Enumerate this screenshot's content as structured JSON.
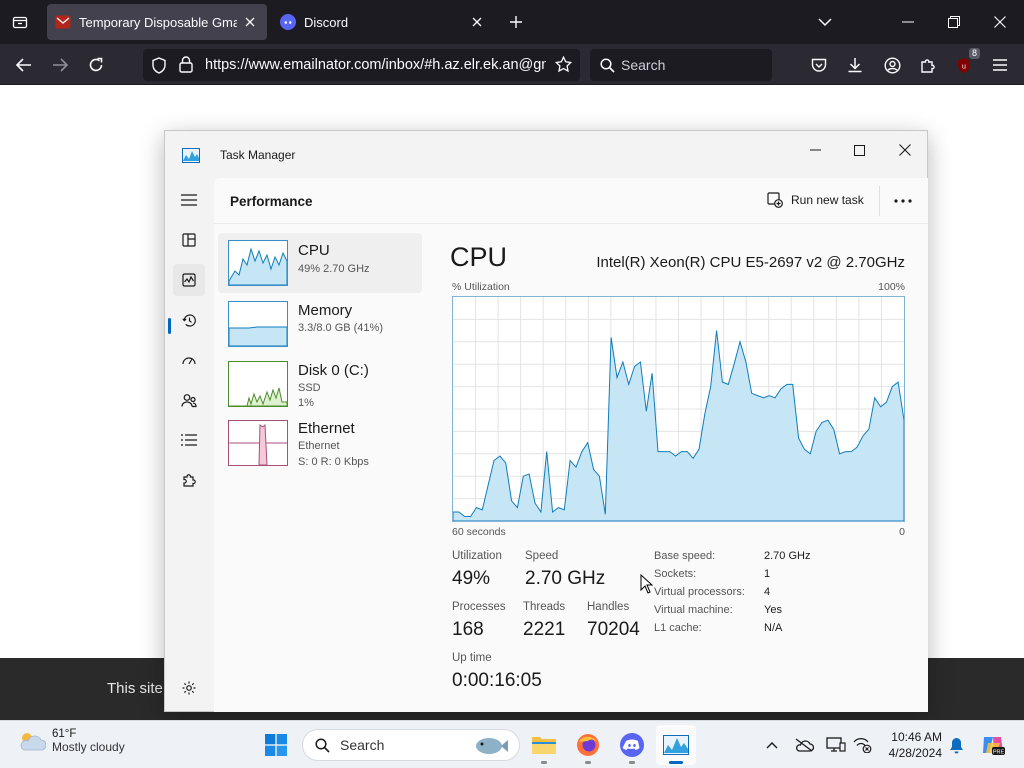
{
  "browser": {
    "tabs": [
      {
        "title": "Temporary Disposable Gmail | T",
        "active": true
      },
      {
        "title": "Discord",
        "active": false
      }
    ],
    "url": "https://www.emailnator.com/inbox/#h.az.elr.ek.an@gmail.com",
    "search_placeholder": "Search",
    "extension_badge": "8"
  },
  "page": {
    "footer_text": "This site"
  },
  "task_manager": {
    "window_title": "Task Manager",
    "section_title": "Performance",
    "run_new_task_label": "Run new task",
    "items": [
      {
        "name": "CPU",
        "sub1": "49% 2.70 GHz",
        "sub2": "",
        "sub3": ""
      },
      {
        "name": "Memory",
        "sub1": "3.3/8.0 GB (41%)",
        "sub2": "",
        "sub3": ""
      },
      {
        "name": "Disk 0 (C:)",
        "sub1": "SSD",
        "sub2": "1%",
        "sub3": ""
      },
      {
        "name": "Ethernet",
        "sub1": "Ethernet",
        "sub2": "S: 0 R: 0 Kbps",
        "sub3": ""
      }
    ],
    "cpu": {
      "title": "CPU",
      "model": "Intel(R) Xeon(R) CPU E5-2697 v2 @ 2.70GHz",
      "y_label": "% Utilization",
      "y_max_label": "100%",
      "x_left_label": "60 seconds",
      "x_right_label": "0",
      "utilization_history_pct": [
        4,
        4,
        2,
        2,
        6,
        5,
        16,
        27,
        29,
        26,
        9,
        6,
        20,
        21,
        8,
        4,
        31,
        4,
        6,
        5,
        27,
        24,
        31,
        35,
        23,
        20,
        3,
        82,
        64,
        71,
        61,
        69,
        71,
        49,
        66,
        31,
        31,
        31,
        29,
        31,
        31,
        28,
        32,
        48,
        60,
        85,
        62,
        61,
        70,
        80,
        71,
        57,
        56,
        55,
        56,
        55,
        59,
        61,
        61,
        37,
        32,
        30,
        40,
        44,
        45,
        41,
        30,
        31,
        31,
        33,
        38,
        41,
        55,
        51,
        53,
        60,
        62,
        45
      ]
    },
    "stats": {
      "utilization_label": "Utilization",
      "utilization": "49%",
      "speed_label": "Speed",
      "speed": "2.70 GHz",
      "processes_label": "Processes",
      "processes": "168",
      "threads_label": "Threads",
      "threads": "2221",
      "handles_label": "Handles",
      "handles": "70204",
      "uptime_label": "Up time",
      "uptime": "0:00:16:05"
    },
    "specs": [
      {
        "key": "Base speed:",
        "value": "2.70 GHz"
      },
      {
        "key": "Sockets:",
        "value": "1"
      },
      {
        "key": "Virtual processors:",
        "value": "4"
      },
      {
        "key": "Virtual machine:",
        "value": "Yes"
      },
      {
        "key": "L1 cache:",
        "value": "N/A"
      }
    ]
  },
  "taskbar": {
    "weather_temp": "61°F",
    "weather_desc": "Mostly cloudy",
    "search_label": "Search",
    "time": "10:46 AM",
    "date": "4/28/2024"
  },
  "colors": {
    "graph_line": "#117dbb",
    "graph_fill": "#c6e6f5",
    "accent": "#0067c0"
  }
}
